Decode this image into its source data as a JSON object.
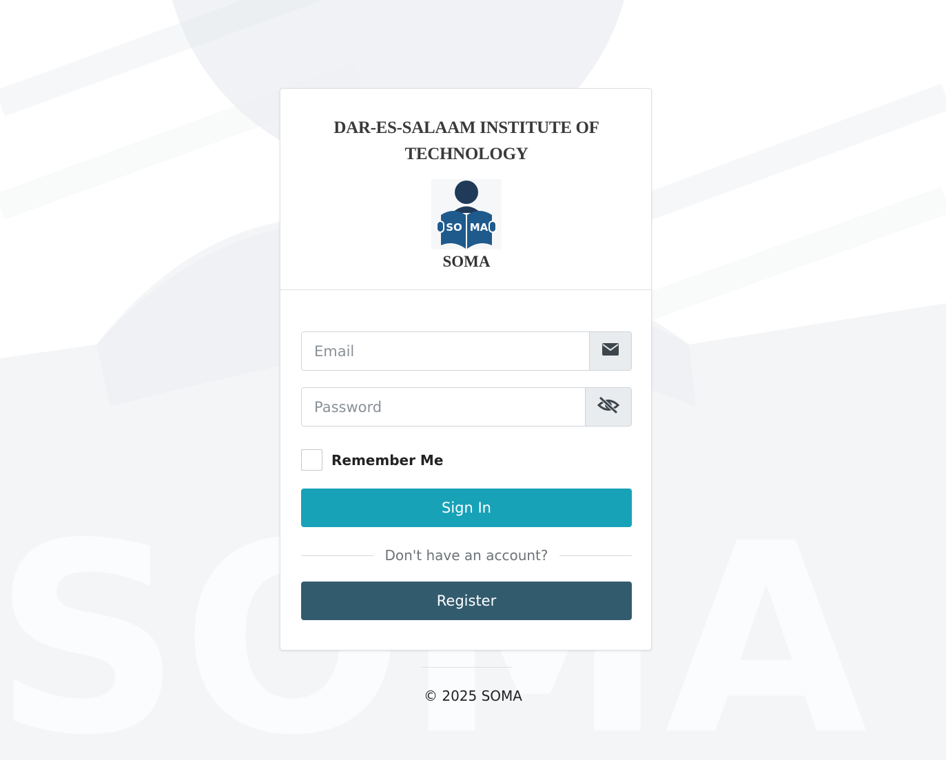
{
  "background": {
    "watermark_text": "SOMA"
  },
  "header": {
    "institute_name": "DAR-ES-SALAAM INSTITUTE OF TECHNOLOGY",
    "logo_badge_left": "SO",
    "logo_badge_right": "MA",
    "logo_caption": "SOMA"
  },
  "form": {
    "email_placeholder": "Email",
    "email_value": "",
    "password_placeholder": "Password",
    "password_value": "",
    "remember_label": "Remember Me",
    "remember_checked": false,
    "signin_label": "Sign In",
    "divider_text": "Don't have an account?",
    "register_label": "Register"
  },
  "footer": {
    "copyright": "© 2025 SOMA"
  },
  "colors": {
    "signin": "#17a2b8",
    "register": "#335b6e",
    "logo_blue": "#1f5a8d",
    "logo_dark": "#203a5a"
  },
  "icons": {
    "email_addon": "envelope-icon",
    "password_addon": "eye-slash-icon"
  }
}
